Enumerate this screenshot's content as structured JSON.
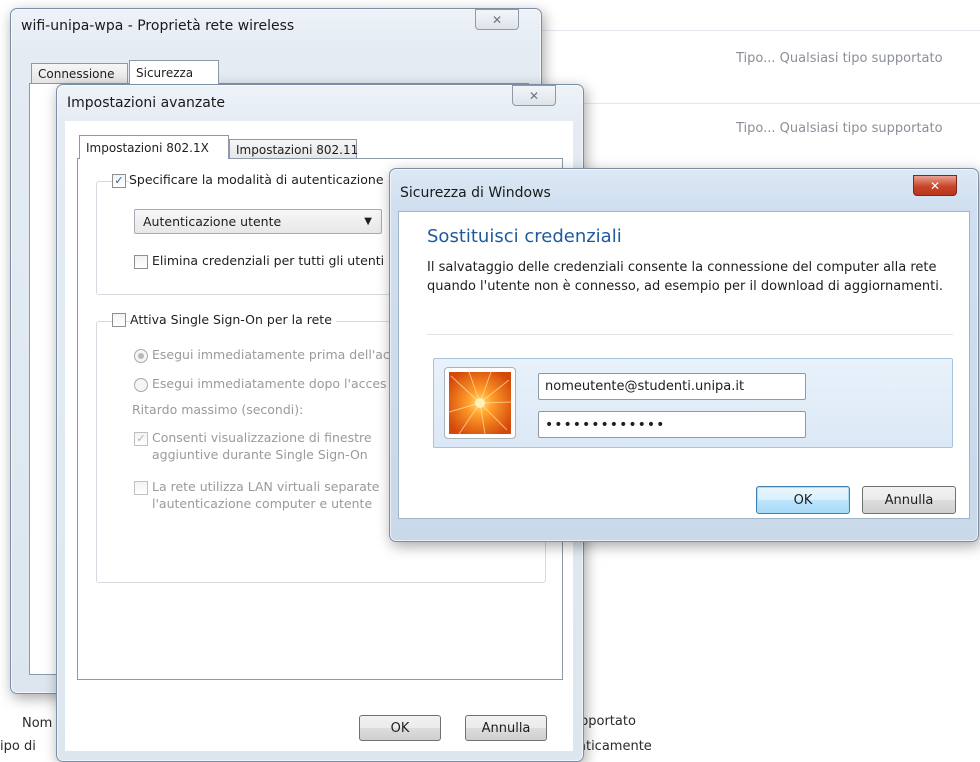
{
  "background": {
    "row1_type": "Tipo... Qualsiasi tipo supportato",
    "row2_type": "Tipo... Qualsiasi tipo supportato",
    "bottom_left_1": "Nom",
    "bottom_left_2": "ipo di",
    "bottom_right_1": "pportato",
    "bottom_right_2": "aticamente"
  },
  "wireless_props": {
    "title": "wifi-unipa-wpa - Proprietà rete wireless",
    "close_glyph": "✕",
    "tabs": [
      "Connessione",
      "Sicurezza"
    ]
  },
  "advanced": {
    "title": "Impostazioni avanzate",
    "close_glyph": "✕",
    "tabs": [
      "Impostazioni 802.1X",
      "Impostazioni 802.11"
    ],
    "specify_auth_label": "Specificare la modalità di autenticazione",
    "auth_mode_value": "Autenticazione utente",
    "delete_creds_label": "Elimina credenziali per tutti gli utenti",
    "sso_label": "Attiva Single Sign-On per la rete",
    "radio_before_label": "Esegui immediatamente prima dell'ac",
    "radio_after_label": "Esegui immediatamente dopo l'acces",
    "max_delay_label": "Ritardo massimo (secondi):",
    "allow_windows_line1": "Consenti visualizzazione di finestre",
    "allow_windows_line2": "aggiuntive durante Single Sign-On",
    "vlan_line1": "La rete utilizza LAN virtuali separate",
    "vlan_line2": "l'autenticazione computer e utente",
    "ok_label": "OK",
    "cancel_label": "Annulla"
  },
  "security": {
    "title": "Sicurezza di Windows",
    "close_glyph": "✕",
    "heading": "Sostituisci credenziali",
    "description": "Il salvataggio delle credenziali consente la connessione del computer alla rete quando l'utente non è connesso, ad esempio per il download di aggiornamenti.",
    "username_value": "nomeutente@studenti.unipa.it",
    "password_value": "•••••••••••••",
    "ok_label": "OK",
    "cancel_label": "Annulla"
  },
  "colors": {
    "heading_blue": "#1e5a9c",
    "close_red": "#c9452a"
  },
  "checkbox_glyph": "✓",
  "dropdown_glyph": "▼"
}
